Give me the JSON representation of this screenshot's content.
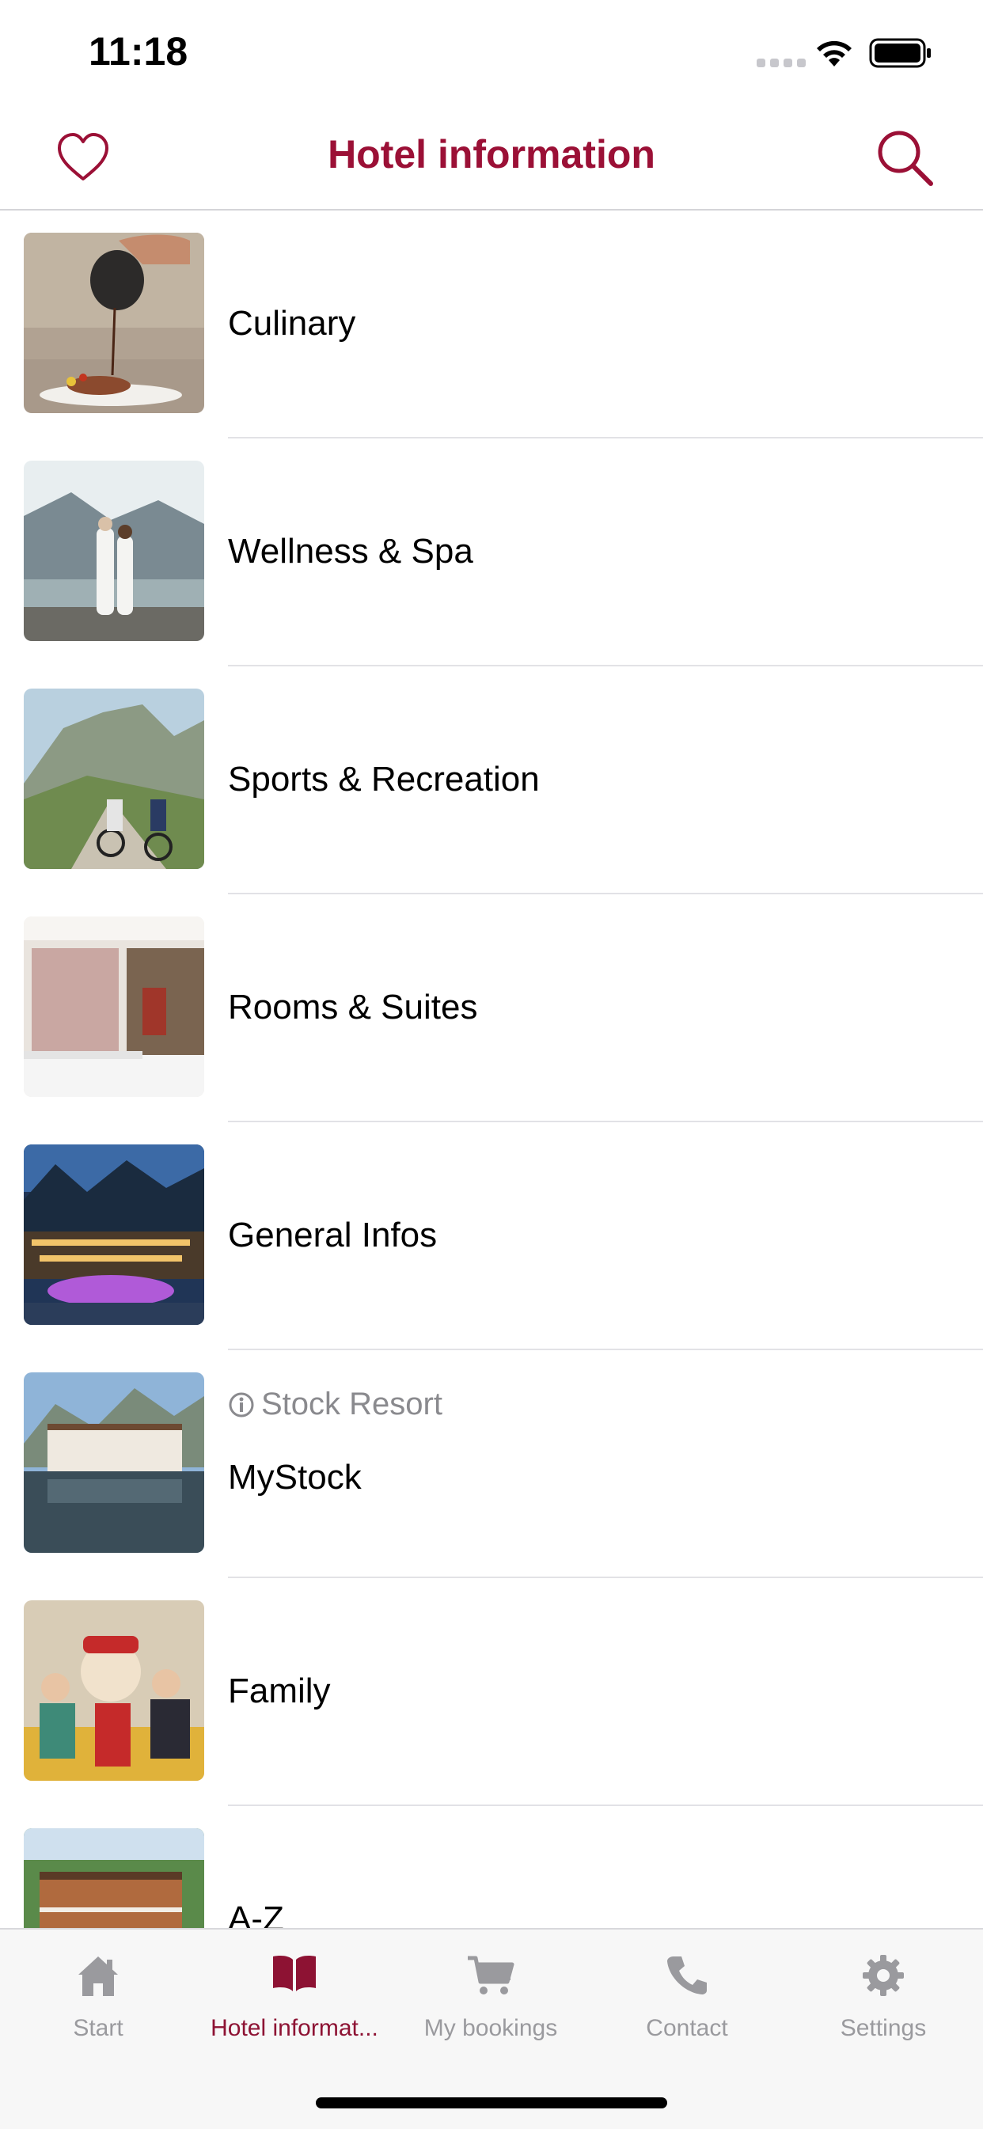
{
  "status_bar": {
    "time": "11:18"
  },
  "nav": {
    "title": "Hotel information"
  },
  "colors": {
    "accent": "#9b1036",
    "tab_inactive": "#9a9a9e",
    "separator": "#e2e2e6"
  },
  "list": [
    {
      "label": "Culinary",
      "thumb": "culinary-photo"
    },
    {
      "label": "Wellness & Spa",
      "thumb": "wellness-photo"
    },
    {
      "label": "Sports & Recreation",
      "thumb": "sports-photo"
    },
    {
      "label": "Rooms & Suites",
      "thumb": "rooms-photo"
    },
    {
      "label": "General Infos",
      "thumb": "general-photo"
    },
    {
      "label": "MyStock",
      "subtitle": "Stock Resort",
      "subtitle_icon": "info-circle-icon",
      "thumb": "mystock-photo"
    },
    {
      "label": "Family",
      "thumb": "family-photo"
    },
    {
      "label": "A-Z",
      "thumb": "a-z-photo"
    }
  ],
  "tabs": [
    {
      "label": "Start",
      "icon": "home-icon",
      "active": false
    },
    {
      "label": "Hotel informat...",
      "icon": "book-icon",
      "active": true
    },
    {
      "label": "My bookings",
      "icon": "cart-icon",
      "active": false
    },
    {
      "label": "Contact",
      "icon": "phone-icon",
      "active": false
    },
    {
      "label": "Settings",
      "icon": "gear-icon",
      "active": false
    }
  ]
}
